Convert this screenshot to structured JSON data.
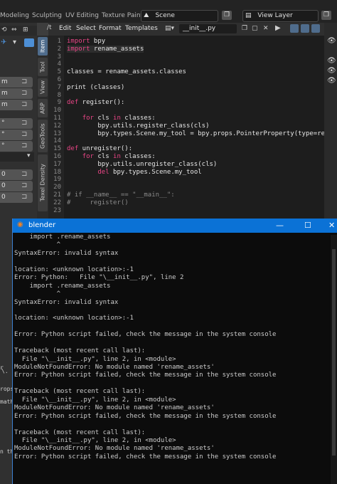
{
  "topbar": {
    "tabs": [
      "Modeling",
      "Sculpting",
      "UV Editing",
      "Texture Paint"
    ],
    "scene_label": "Scene",
    "view_layer_label": "View Layer"
  },
  "editor": {
    "menus": [
      "Edit",
      "Select",
      "Format",
      "Templates"
    ],
    "filename": "__init__.py",
    "line_numbers": [
      "1",
      "2",
      "3",
      "4",
      "5",
      "6",
      "7",
      "8",
      "9",
      "10",
      "11",
      "12",
      "13",
      "14",
      "15",
      "16",
      "17",
      "18",
      "19",
      "20",
      "21",
      "22",
      "23"
    ],
    "lines": [
      "import bpy",
      "import rename_assets",
      "",
      "",
      "classes = rename_assets.classes",
      "",
      "print (classes)",
      "",
      "def register():",
      "",
      "    for cls in classes:",
      "        bpy.utils.register_class(cls)",
      "        bpy.types.Scene.my_tool = bpy.props.PointerProperty(type=rename",
      "",
      "def unregister():",
      "    for cls in classes:",
      "        bpy.utils.unregister_class(cls)",
      "        del bpy.types.Scene.my_tool",
      "",
      "",
      "# if __name__ == \"__main__\":",
      "#     register()",
      ""
    ]
  },
  "sidebar_tabs": [
    "Item",
    "Tool",
    "View",
    "ARP",
    "GeoTools",
    "Texel Density"
  ],
  "left_panel": {
    "rows": [
      "m",
      "m",
      "m",
      "°",
      "°",
      "°",
      "0",
      "0",
      "0"
    ],
    "fragments": [
      "r",
      "\\.",
      "rops.",
      "math",
      "n th"
    ]
  },
  "console": {
    "title": "blender",
    "lines": [
      "    import .rename_assets",
      "           ^",
      "SyntaxError: invalid syntax",
      "",
      "location: <unknown location>:-1",
      "Error: Python:   File \"\\__init__.py\", line 2",
      "    import .rename_assets",
      "           ^",
      "SyntaxError: invalid syntax",
      "",
      "location: <unknown location>:-1",
      "",
      "Error: Python script failed, check the message in the system console",
      "",
      "Traceback (most recent call last):",
      "  File \"\\__init__.py\", line 2, in <module>",
      "ModuleNotFoundError: No module named 'rename_assets'",
      "Error: Python script failed, check the message in the system console",
      "",
      "Traceback (most recent call last):",
      "  File \"\\__init__.py\", line 2, in <module>",
      "ModuleNotFoundError: No module named 'rename_assets'",
      "Error: Python script failed, check the message in the system console",
      "",
      "Traceback (most recent call last):",
      "  File \"\\__init__.py\", line 2, in <module>",
      "ModuleNotFoundError: No module named 'rename_assets'",
      "Error: Python script failed, check the message in the system console"
    ],
    "controls": {
      "minimize": "—",
      "maximize": "☐",
      "close": "✕"
    }
  },
  "colors": {
    "keyword": "#e94586",
    "console_title": "#0b72d6",
    "active_tab": "#4f6c8c"
  }
}
